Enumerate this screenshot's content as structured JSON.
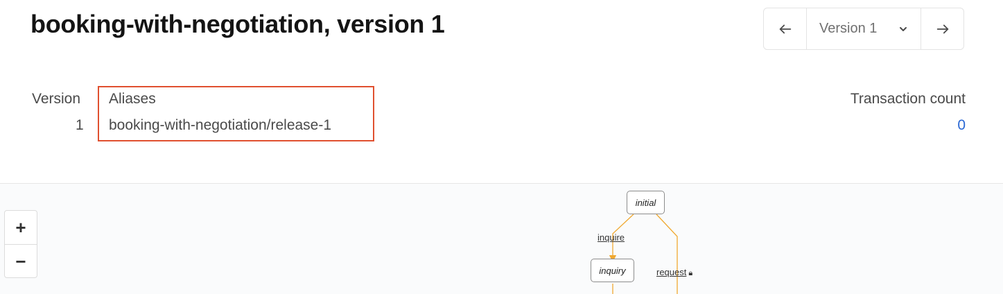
{
  "header": {
    "title": "booking-with-negotiation, version 1",
    "version_selector": {
      "selected": "Version 1",
      "prev_icon": "arrow-left-icon",
      "next_icon": "arrow-right-icon",
      "dropdown_icon": "chevron-down-icon"
    }
  },
  "details": {
    "version_label": "Version",
    "version_value": "1",
    "aliases_label": "Aliases",
    "aliases_value": "booking-with-negotiation/release-1",
    "transaction_count_label": "Transaction count",
    "transaction_count_value": "0"
  },
  "graph": {
    "zoom_in": "+",
    "zoom_out": "−",
    "nodes": {
      "initial": "initial",
      "inquiry": "inquiry"
    },
    "transitions": {
      "inquire": "inquire",
      "request": "request",
      "request_lock_icon": "lock-icon"
    },
    "colors": {
      "edge": "#f0a830",
      "highlight_border": "#e0502f",
      "link": "#2a68d4"
    }
  }
}
